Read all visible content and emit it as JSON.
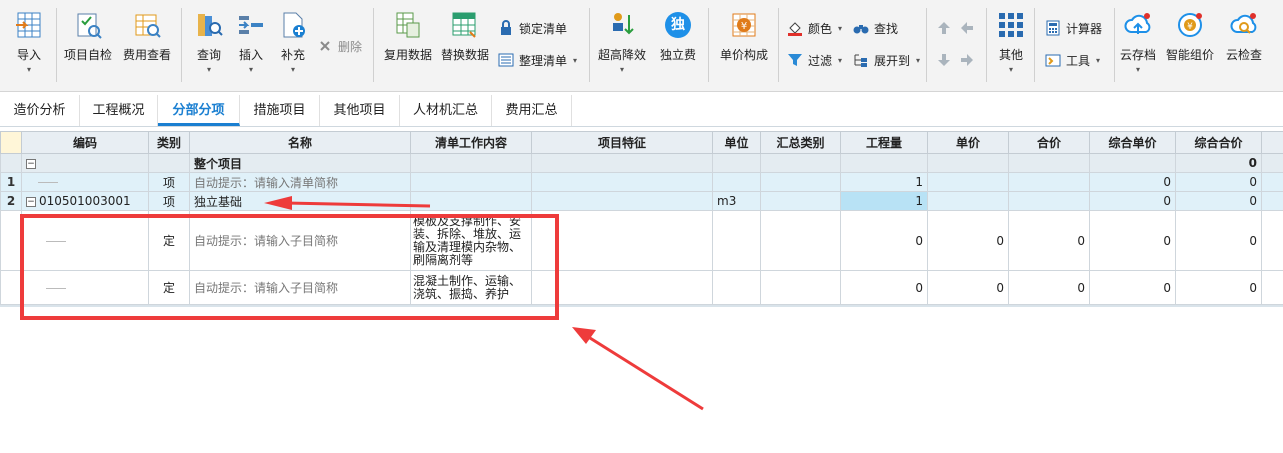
{
  "toolbar": {
    "import": "导入",
    "self_check": "项目自检",
    "fee_view": "费用查看",
    "query": "查询",
    "insert": "插入",
    "supplement": "补充",
    "delete": "删除",
    "reuse_data": "复用数据",
    "replace_data": "替换数据",
    "lock_list": "锁定清单",
    "arrange_list": "整理清单",
    "ultra_reduce": "超高降效",
    "independent_fee": "独立费",
    "independent_glyph": "独",
    "unit_price_comp": "单价构成",
    "color": "颜色",
    "find": "查找",
    "filter": "过滤",
    "expand_to": "展开到",
    "other": "其他",
    "calculator": "计算器",
    "tools": "工具",
    "cloud_archive": "云存档",
    "smart_price": "智能组价",
    "cloud_check": "云检查"
  },
  "tabs": [
    "造价分析",
    "工程概况",
    "分部分项",
    "措施项目",
    "其他项目",
    "人材机汇总",
    "费用汇总"
  ],
  "active_tab": "分部分项",
  "columns": [
    "编码",
    "类别",
    "名称",
    "清单工作内容",
    "项目特征",
    "单位",
    "汇总类别",
    "工程量",
    "单价",
    "合价",
    "综合单价",
    "综合合价"
  ],
  "rows": {
    "total": {
      "expander": "−",
      "name": "整个项目",
      "comp_total": "0"
    },
    "row1": {
      "rn": "1",
      "type": "项",
      "name": "自动提示：请输入清单简称",
      "qty": "1",
      "comp_unit": "0",
      "comp_total": "0"
    },
    "row2": {
      "rn": "2",
      "expander": "−",
      "code": "010501003001",
      "type": "项",
      "name": "独立基础",
      "unit": "m3",
      "qty": "1",
      "comp_unit": "0",
      "comp_total": "0"
    },
    "sub1": {
      "type": "定",
      "name": "自动提示：请输入子目简称",
      "work": "模板及支撑制作、安装、拆除、堆放、运输及清理模内杂物、刷隔离剂等",
      "qty": "0",
      "price": "0",
      "total": "0",
      "comp_unit": "0",
      "comp_total": "0"
    },
    "sub2": {
      "type": "定",
      "name": "自动提示：请输入子目简称",
      "work": "混凝土制作、运输、浇筑、振捣、养护",
      "qty": "0",
      "price": "0",
      "total": "0",
      "comp_unit": "0",
      "comp_total": "0"
    }
  },
  "colors": {
    "accent": "#1a7fd1",
    "annotation": "#ee3b3b",
    "row_number_bg": "#fff6d8"
  }
}
